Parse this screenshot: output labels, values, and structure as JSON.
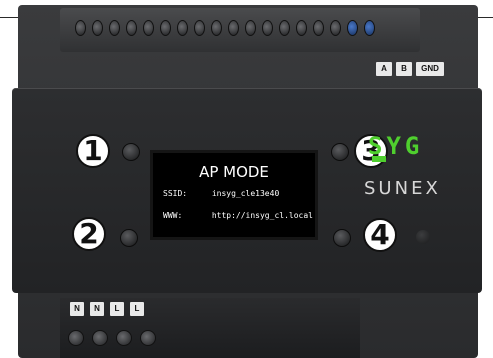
{
  "device": {
    "terminals_top": [
      "A",
      "B",
      "GND"
    ],
    "terminals_bottom": [
      "N",
      "N",
      "L",
      "L"
    ],
    "callouts": [
      "1",
      "2",
      "3",
      "4"
    ],
    "display": {
      "title": "AP MODE",
      "ssid_label": "SSID:",
      "ssid_value": "insyg_cle13e40",
      "www_label": "WWW:",
      "www_value": "http://insyg_cl.local"
    },
    "brand": {
      "logo_text": "SYG",
      "name": "SUNEX"
    }
  },
  "colors": {
    "housing": "#2d2e30",
    "screen": "#000000",
    "brand_green": "#4fcf2e",
    "callout_fill": "#ffffff"
  }
}
